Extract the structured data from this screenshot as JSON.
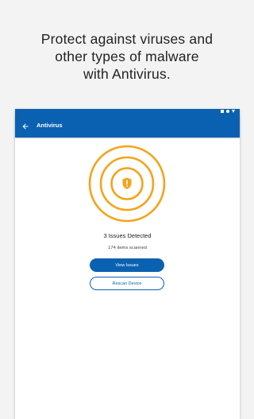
{
  "promo": {
    "line1": "Protect against viruses and",
    "line2": "other types of malware",
    "line3": "with Antivirus."
  },
  "appbar": {
    "title": "Antivirus",
    "back_icon": "back-arrow-icon"
  },
  "status_icons": [
    "wifi-icon",
    "signal-icon",
    "battery-icon"
  ],
  "scan": {
    "result_title": "3 Issues Detected",
    "items_scanned": "174 items scanned",
    "issues_count": 3,
    "center_icon": "shield-alert-icon"
  },
  "actions": {
    "view_issues": "View Issues",
    "rescan": "Rescan Device"
  },
  "colors": {
    "brand_blue": "#0b61b1",
    "warning_orange": "#f5a31a",
    "background": "#f3f3f3"
  }
}
